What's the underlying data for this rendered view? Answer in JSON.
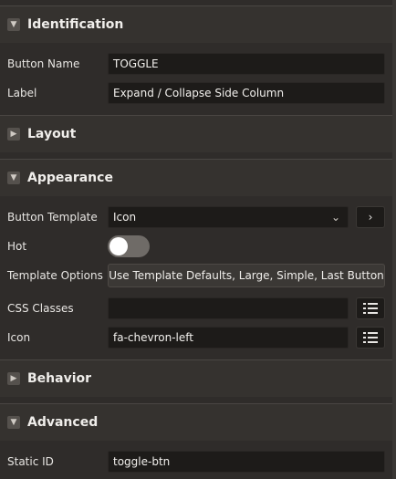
{
  "sections": {
    "identification": "Identification",
    "layout": "Layout",
    "appearance": "Appearance",
    "behavior": "Behavior",
    "advanced": "Advanced"
  },
  "fields": {
    "button_name": {
      "label": "Button Name",
      "value": "TOGGLE"
    },
    "label": {
      "label": "Label",
      "value": "Expand / Collapse Side Column"
    },
    "button_template": {
      "label": "Button Template",
      "value": "Icon"
    },
    "hot": {
      "label": "Hot",
      "checked": false
    },
    "template_options": {
      "label": "Template Options",
      "value": "Use Template Defaults, Large, Simple, Last Button"
    },
    "css_classes": {
      "label": "CSS Classes",
      "value": ""
    },
    "icon": {
      "label": "Icon",
      "value": "fa-chevron-left"
    },
    "static_id": {
      "label": "Static ID",
      "value": "toggle-btn"
    }
  },
  "icons": {
    "expanded": "chevron-down-icon",
    "collapsed": "chevron-right-icon",
    "navigate": "chevron-right-icon",
    "list": "list-icon"
  }
}
